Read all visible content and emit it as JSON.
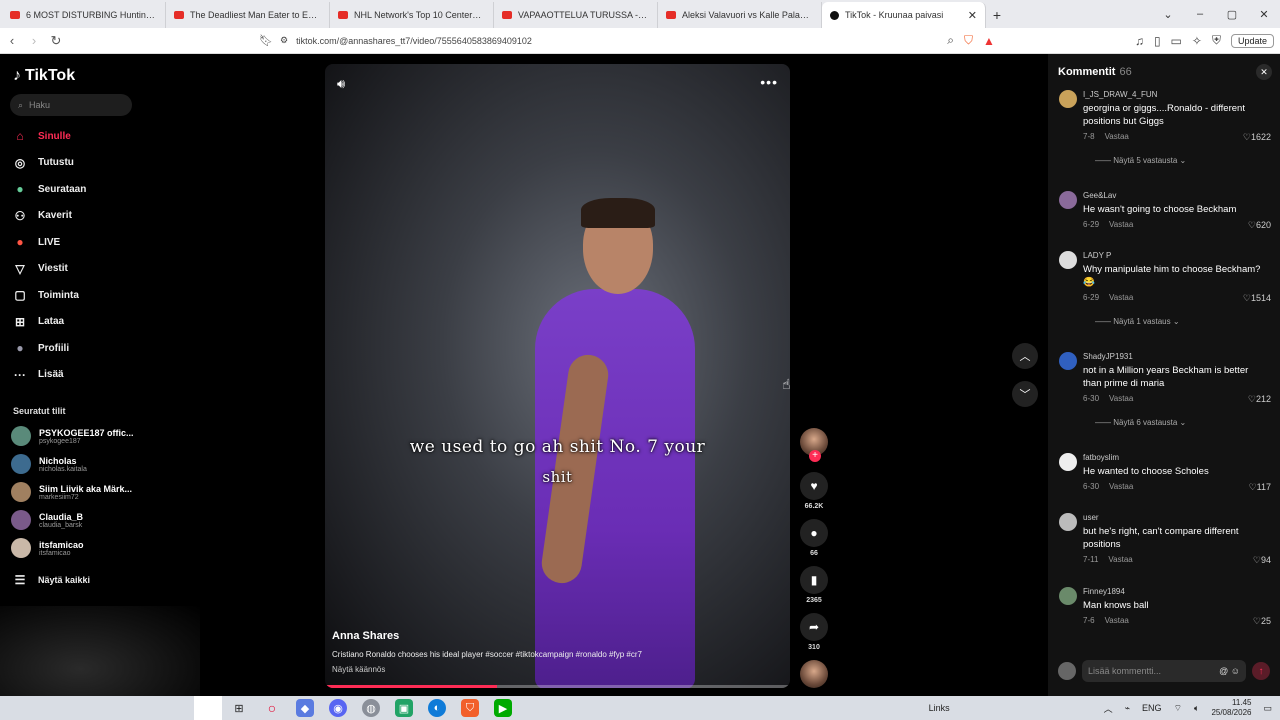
{
  "browser": {
    "tabs": [
      {
        "title": "6 MOST DISTURBING Hunting Encou",
        "icon": "youtube-icon"
      },
      {
        "title": "The Deadliest Man Eater to Ever Exist",
        "icon": "youtube-icon"
      },
      {
        "title": "NHL Network's Top 10 Centers Right",
        "icon": "youtube-icon"
      },
      {
        "title": "VAPAAOTTELUA TURUSSA - YouTube",
        "icon": "youtube-icon"
      },
      {
        "title": "Aleksi Valavuori vs Kalle Palander @",
        "icon": "youtube-icon"
      },
      {
        "title": "TikTok - Kruunaa paivasi",
        "icon": "tiktok-icon",
        "active": true
      }
    ],
    "url": "tiktok.com/@annashares_tt7/video/7555640583869409102",
    "update_label": "Update"
  },
  "sidebar": {
    "logo": "TikTok",
    "search_placeholder": "Haku",
    "nav": [
      {
        "label": "Sinulle",
        "icon": "home-icon",
        "active": true
      },
      {
        "label": "Tutustu",
        "icon": "compass-icon"
      },
      {
        "label": "Seurataan",
        "icon": "avatar-icon"
      },
      {
        "label": "Kaverit",
        "icon": "friends-icon"
      },
      {
        "label": "LIVE",
        "icon": "live-icon"
      },
      {
        "label": "Viestit",
        "icon": "messages-icon"
      },
      {
        "label": "Toiminta",
        "icon": "activity-icon"
      },
      {
        "label": "Lataa",
        "icon": "upload-icon"
      },
      {
        "label": "Profiili",
        "icon": "profile-icon"
      },
      {
        "label": "Lisää",
        "icon": "more-icon"
      }
    ],
    "following_title": "Seuratut tilit",
    "following": [
      {
        "name": "PSYKOGEE187 offic...",
        "user": "psykogee187"
      },
      {
        "name": "Nicholas",
        "user": "nicholas.kaitala"
      },
      {
        "name": "Siim Liivik aka Märk...",
        "user": "markesiim72"
      },
      {
        "name": "Claudia_B",
        "user": "claudia_barsk"
      },
      {
        "name": "itsfamicao",
        "user": "itsfamicao"
      }
    ],
    "show_all": "Näytä kaikki"
  },
  "video": {
    "caption_line1": "we used to go ah shit No. 7 your",
    "caption_line2": "shit",
    "author": "Anna Shares",
    "description": "Cristiano Ronaldo chooses his ideal player #soccer #tiktokcampaign #ronaldo #fyp #cr7",
    "translate": "Näytä käännös",
    "progress": 0.37
  },
  "actions": {
    "likes": "66.2K",
    "comments": "66",
    "saves": "2365",
    "shares": "310"
  },
  "comments": {
    "title": "Kommentit",
    "count": "66",
    "items": [
      {
        "user": "I_JS_DRAW_4_FUN",
        "text": "georgina or giggs....Ronaldo - different positions but Giggs",
        "date": "7-8",
        "reply": "Vastaa",
        "likes": "1622",
        "more": "Näytä 5 vastausta"
      },
      {
        "user": "Gee&Lav",
        "text": "He wasn't going to choose Beckham",
        "date": "6-29",
        "reply": "Vastaa",
        "likes": "620"
      },
      {
        "user": "LADY P",
        "text": "Why manipulate him to choose Beckham? 😂",
        "date": "6-29",
        "reply": "Vastaa",
        "likes": "1514",
        "more": "Näytä 1 vastaus"
      },
      {
        "user": "ShadyJP1931",
        "text": "not in a Million years Beckham is better than prime di maria",
        "date": "6-30",
        "reply": "Vastaa",
        "likes": "212",
        "more": "Näytä 6 vastausta"
      },
      {
        "user": "fatboyslim",
        "text": "He wanted to choose Scholes",
        "date": "6-30",
        "reply": "Vastaa",
        "likes": "117"
      },
      {
        "user": "user",
        "text": "but he's right, can't compare different positions",
        "date": "7-11",
        "reply": "Vastaa",
        "likes": "94"
      },
      {
        "user": "Finney1894",
        "text": "Man knows ball",
        "date": "7-6",
        "reply": "Vastaa",
        "likes": "25"
      }
    ],
    "input_placeholder": "Lisää kommentti..."
  },
  "taskbar": {
    "links": "Links",
    "lang": "ENG",
    "time": "11.45",
    "date": "25/08/2026"
  },
  "colors": {
    "accent": "#fe2c55",
    "shirt": "#6a2db5"
  }
}
